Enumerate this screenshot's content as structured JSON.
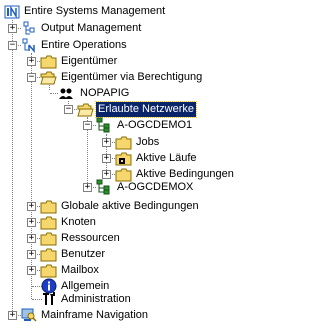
{
  "tree": {
    "root_label": "Entire Systems Management",
    "items": [
      {
        "label": "Output Management"
      },
      {
        "label": "Entire Operations"
      },
      {
        "label": "Eigentümer"
      },
      {
        "label": "Eigentümer via Berechtigung"
      },
      {
        "label": "NOPAPIG"
      },
      {
        "label": "Erlaubte Netzwerke"
      },
      {
        "label": "A-OGCDEMO1"
      },
      {
        "label": "Jobs"
      },
      {
        "label": "Aktive Läufe"
      },
      {
        "label": "Aktive Bedingungen"
      },
      {
        "label": "A-OGCDEMOX"
      },
      {
        "label": "Globale aktive Bedingungen"
      },
      {
        "label": "Knoten"
      },
      {
        "label": "Ressourcen"
      },
      {
        "label": "Benutzer"
      },
      {
        "label": "Mailbox"
      },
      {
        "label": "Allgemein"
      },
      {
        "label": "Administration"
      },
      {
        "label": "Mainframe Navigation"
      }
    ]
  },
  "colors": {
    "selection": "#0a246a",
    "folder": "#f5d76e",
    "info": "#1e3fc4"
  }
}
